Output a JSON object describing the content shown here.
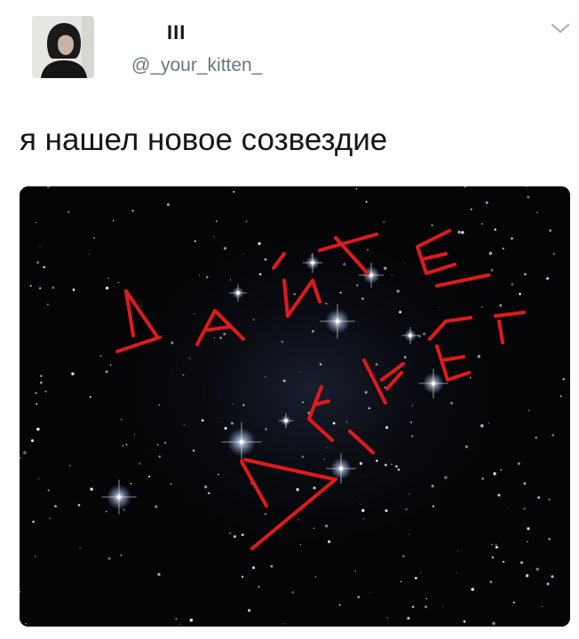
{
  "tweet": {
    "author": {
      "display_name": "III",
      "handle": "@_your_kitten_",
      "avatar_icon": "profile-photo-avatar"
    },
    "menu_icon": "chevron-down-icon",
    "text": "я нашел новое созвездие",
    "media": {
      "description_icon": "starfield-constellation-image"
    }
  },
  "colors": {
    "text_primary": "#14171a",
    "text_secondary": "#657786",
    "chevron": "#aab8c2",
    "drawing_red": "#e01a1a",
    "sky": "#050508"
  }
}
